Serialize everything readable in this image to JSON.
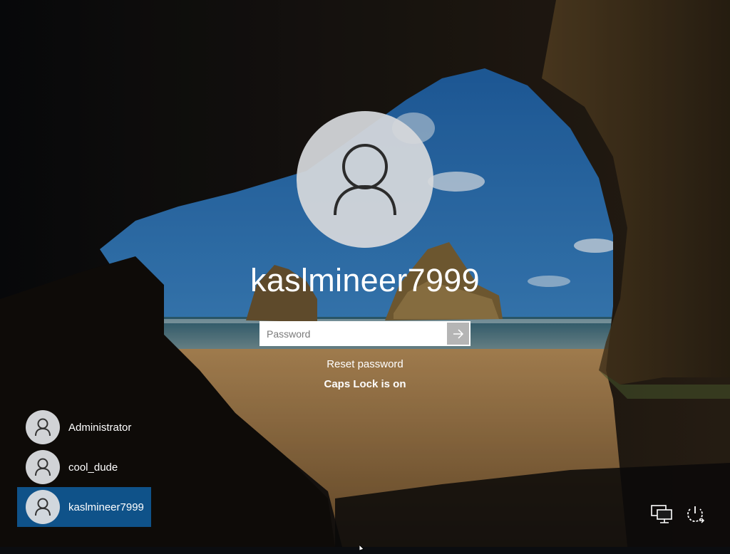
{
  "lock_screen": {
    "current_user": "kaslmineer7999",
    "password_placeholder": "Password",
    "reset_password_label": "Reset password",
    "caps_lock_message": "Caps Lock is on"
  },
  "user_list": [
    {
      "name": "Administrator",
      "selected": false
    },
    {
      "name": "cool_dude",
      "selected": false
    },
    {
      "name": "kaslmineer7999",
      "selected": true
    }
  ],
  "tray": {
    "network_icon": "network-icon",
    "power_icon": "power-icon"
  },
  "colors": {
    "selected_user_bg": "#0f5289",
    "avatar_bg": "#d6d8dc",
    "sky": "#2f6fae",
    "sand": "#9c7a4a",
    "cave": "#0b0d10"
  }
}
